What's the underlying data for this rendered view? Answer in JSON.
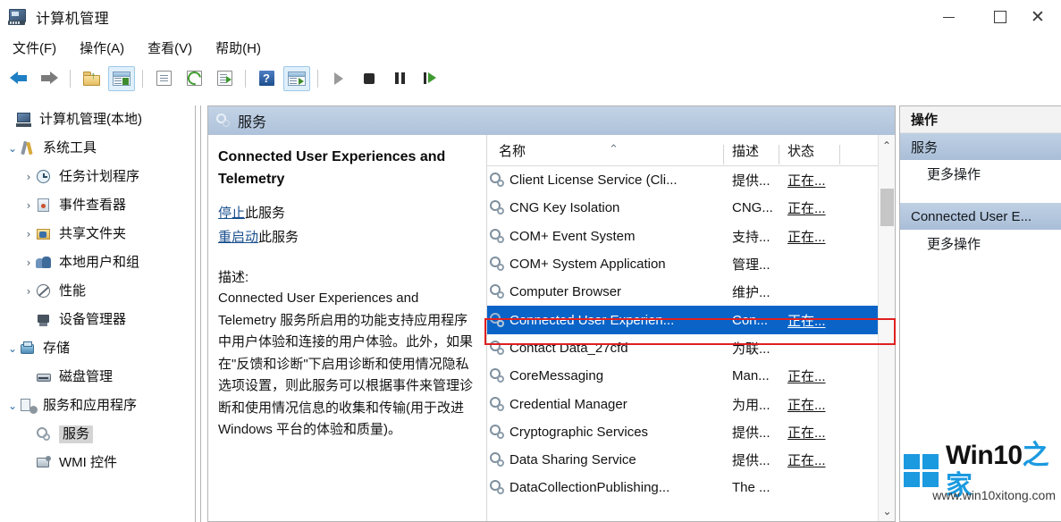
{
  "window": {
    "title": "计算机管理",
    "icon": "computer-management-icon",
    "minimize_label": "",
    "maximize_label": "",
    "close_label": "✕"
  },
  "menu": {
    "items": [
      {
        "label": "文件(F)",
        "name": "menu-file"
      },
      {
        "label": "操作(A)",
        "name": "menu-action"
      },
      {
        "label": "查看(V)",
        "name": "menu-view"
      },
      {
        "label": "帮助(H)",
        "name": "menu-help"
      }
    ]
  },
  "toolbar": {
    "buttons": [
      {
        "name": "back-arrow-icon"
      },
      {
        "name": "forward-arrow-icon"
      },
      {
        "name": "up-folder-icon"
      },
      {
        "name": "show-hide-tree-icon"
      },
      {
        "name": "properties-icon"
      },
      {
        "name": "refresh-icon"
      },
      {
        "name": "export-list-icon"
      },
      {
        "name": "help-icon"
      },
      {
        "name": "show-action-pane-icon"
      },
      {
        "name": "start-service-icon"
      },
      {
        "name": "stop-service-icon"
      },
      {
        "name": "pause-service-icon"
      },
      {
        "name": "restart-service-icon"
      }
    ]
  },
  "tree": {
    "items": [
      {
        "label": "计算机管理(本地)",
        "indent": 0,
        "twisty": "",
        "icon": "computer-icon",
        "selected": false
      },
      {
        "label": "系统工具",
        "indent": 1,
        "twisty": "v",
        "icon": "system-tools-icon",
        "selected": false
      },
      {
        "label": "任务计划程序",
        "indent": 2,
        "twisty": ">",
        "icon": "task-scheduler-icon",
        "selected": false
      },
      {
        "label": "事件查看器",
        "indent": 2,
        "twisty": ">",
        "icon": "event-viewer-icon",
        "selected": false
      },
      {
        "label": "共享文件夹",
        "indent": 2,
        "twisty": ">",
        "icon": "shared-folders-icon",
        "selected": false
      },
      {
        "label": "本地用户和组",
        "indent": 2,
        "twisty": ">",
        "icon": "local-users-groups-icon",
        "selected": false
      },
      {
        "label": "性能",
        "indent": 2,
        "twisty": ">",
        "icon": "performance-icon",
        "selected": false
      },
      {
        "label": "设备管理器",
        "indent": 2,
        "twisty": "",
        "icon": "device-manager-icon",
        "selected": false
      },
      {
        "label": "存储",
        "indent": 1,
        "twisty": "v",
        "icon": "storage-icon",
        "selected": false
      },
      {
        "label": "磁盘管理",
        "indent": 2,
        "twisty": "",
        "icon": "disk-management-icon",
        "selected": false
      },
      {
        "label": "服务和应用程序",
        "indent": 1,
        "twisty": "v",
        "icon": "services-applications-icon",
        "selected": false
      },
      {
        "label": "服务",
        "indent": 2,
        "twisty": "",
        "icon": "services-gear-icon",
        "selected": true
      },
      {
        "label": "WMI 控件",
        "indent": 2,
        "twisty": "",
        "icon": "wmi-control-icon",
        "selected": false
      }
    ]
  },
  "center": {
    "header_title": "服务",
    "header_icon": "services-gear-icon"
  },
  "detail": {
    "title": "Connected User Experiences and Telemetry",
    "links": [
      {
        "link_text": "停止",
        "rest_text": "此服务",
        "name": "stop-service-link"
      },
      {
        "link_text": "重启动",
        "rest_text": "此服务",
        "name": "restart-service-link"
      }
    ],
    "description_label": "描述:",
    "description_body": "Connected User Experiences and Telemetry 服务所启用的功能支持应用程序中用户体验和连接的用户体验。此外，如果在\"反馈和诊断\"下启用诊断和使用情况隐私选项设置，则此服务可以根据事件来管理诊断和使用情况信息的收集和传输(用于改进 Windows 平台的体验和质量)。"
  },
  "list": {
    "columns": [
      {
        "label": "名称",
        "name": "column-name",
        "sorted": "asc"
      },
      {
        "label": "描述",
        "name": "column-description"
      },
      {
        "label": "状态",
        "name": "column-status"
      }
    ],
    "rows": [
      {
        "name": "Client License Service (Cli...",
        "desc": "提供...",
        "state": "正在...",
        "selected": false
      },
      {
        "name": "CNG Key Isolation",
        "desc": "CNG...",
        "state": "正在...",
        "selected": false
      },
      {
        "name": "COM+ Event System",
        "desc": "支持...",
        "state": "正在...",
        "selected": false
      },
      {
        "name": "COM+ System Application",
        "desc": "管理...",
        "state": "",
        "selected": false
      },
      {
        "name": "Computer Browser",
        "desc": "维护...",
        "state": "",
        "selected": false
      },
      {
        "name": "Connected User Experien...",
        "desc": "Con...",
        "state": "正在...",
        "selected": true
      },
      {
        "name": "Contact Data_27cfd",
        "desc": "为联...",
        "state": "",
        "selected": false
      },
      {
        "name": "CoreMessaging",
        "desc": "Man...",
        "state": "正在...",
        "selected": false
      },
      {
        "name": "Credential Manager",
        "desc": "为用...",
        "state": "正在...",
        "selected": false
      },
      {
        "name": "Cryptographic Services",
        "desc": "提供...",
        "state": "正在...",
        "selected": false
      },
      {
        "name": "Data Sharing Service",
        "desc": "提供...",
        "state": "正在...",
        "selected": false
      },
      {
        "name": "DataCollectionPublishing...",
        "desc": "The ...",
        "state": "",
        "selected": false
      }
    ],
    "scroll_up": "⌃",
    "scroll_down": "⌄"
  },
  "actions": {
    "header": "操作",
    "groups": [
      {
        "title": "服务",
        "name": "actions-group-services",
        "items": [
          {
            "label": "更多操作",
            "name": "more-actions-services"
          }
        ]
      },
      {
        "title": "Connected User E...",
        "name": "actions-group-selected-service",
        "items": [
          {
            "label": "更多操作",
            "name": "more-actions-selected"
          }
        ]
      }
    ]
  },
  "watermark": {
    "brand_en": "Win10",
    "brand_cn": "之家",
    "url": "www.win10xitong.com"
  },
  "colors": {
    "selection_blue": "#0a64c8",
    "annotation_red": "#e02020",
    "header_gradient_top": "#c3d3e6",
    "header_gradient_bottom": "#aec2da",
    "link_blue": "#1a4f8f",
    "watermark_blue": "#1b9ae0"
  }
}
